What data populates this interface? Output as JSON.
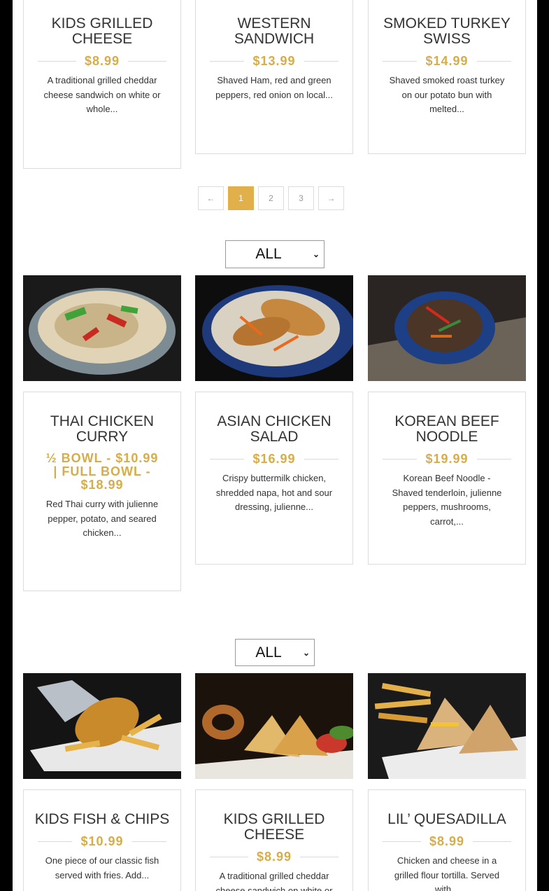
{
  "pagination": {
    "prev": "←",
    "pages": [
      "1",
      "2",
      "3"
    ],
    "next": "→"
  },
  "filters": [
    "ALL",
    "ALL"
  ],
  "row1": [
    {
      "title": "KIDS GRILLED CHEESE",
      "price": "$8.99",
      "desc": "A traditional grilled cheddar cheese sandwich on white or whole..."
    },
    {
      "title": "WESTERN SANDWICH",
      "price": "$13.99",
      "desc": "Shaved Ham, red and green peppers, red onion on local..."
    },
    {
      "title": "SMOKED TURKEY SWISS",
      "price": "$14.99",
      "desc": "Shaved smoked roast turkey on our potato bun with melted..."
    }
  ],
  "row2": [
    {
      "title": "THAI CHICKEN CURRY",
      "price": "½ BOWL - $10.99 | FULL BOWL - $18.99",
      "desc": "Red Thai curry with julienne pepper, potato, and seared chicken..."
    },
    {
      "title": "ASIAN CHICKEN SALAD",
      "price": "$16.99",
      "desc": "Crispy buttermilk chicken, shredded napa, hot and sour dressing, julienne..."
    },
    {
      "title": "KOREAN BEEF NOODLE",
      "price": "$19.99",
      "desc": "Korean Beef Noodle - Shaved tenderloin, julienne peppers, mushrooms, carrot,..."
    }
  ],
  "row3": [
    {
      "title": "KIDS FISH & CHIPS",
      "price": "$10.99",
      "desc": "One piece of our classic fish served with fries. Add..."
    },
    {
      "title": "KIDS GRILLED CHEESE",
      "price": "$8.99",
      "desc": "A traditional grilled cheddar cheese sandwich on white or whole..."
    },
    {
      "title": "LIL’ QUESADILLA",
      "price": "$8.99",
      "desc": "Chicken and cheese in a grilled flour tortilla. Served with..."
    }
  ]
}
